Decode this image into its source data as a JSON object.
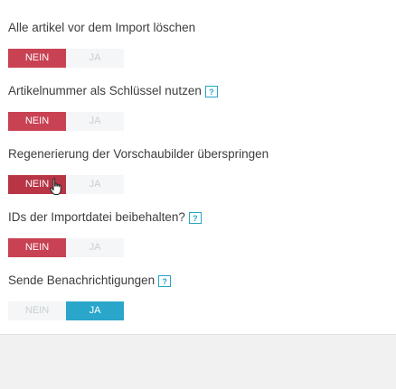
{
  "settings": [
    {
      "label": "Alle artikel vor dem Import löschen",
      "help": "",
      "no": "NEIN",
      "yes": "JA",
      "value": "no"
    },
    {
      "label": "Artikelnummer als Schlüssel nutzen",
      "help": "?",
      "no": "NEIN",
      "yes": "JA",
      "value": "no"
    },
    {
      "label": "Regenerierung der Vorschaubilder überspringen",
      "help": "",
      "no": "NEIN",
      "yes": "JA",
      "value": "no"
    },
    {
      "label": "IDs der Importdatei beibehalten?",
      "help": "?",
      "no": "NEIN",
      "yes": "JA",
      "value": "no"
    },
    {
      "label": "Sende Benachrichtigungen",
      "help": "?",
      "no": "NEIN",
      "yes": "JA",
      "value": "yes"
    }
  ],
  "colors": {
    "no_active": "#c94253",
    "yes_active": "#2aa6cb",
    "inactive_bg": "#f4f6f7",
    "inactive_text": "#c8d0d4",
    "help": "#25a5c7"
  },
  "icons": {
    "help": "question-icon",
    "cursor": "hand-pointer-icon"
  }
}
